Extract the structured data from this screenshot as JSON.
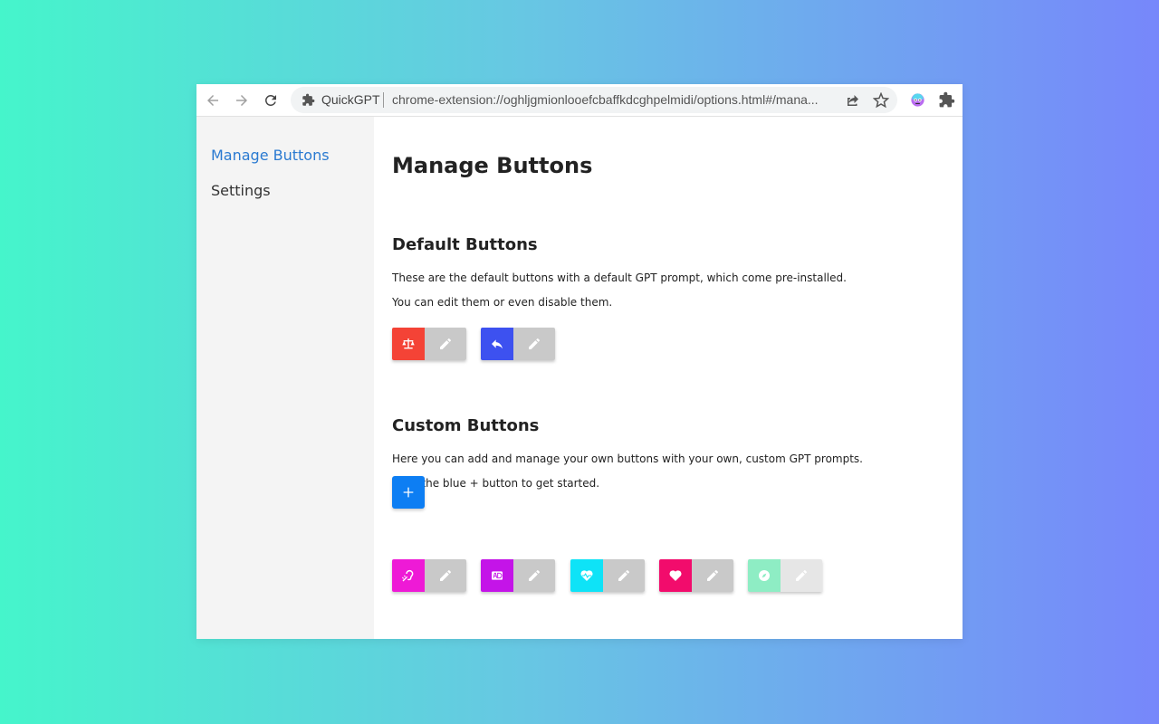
{
  "browser": {
    "site_name": "QuickGPT",
    "url": "chrome-extension://oghljgmionlooefcbaffkdcghpelmidi/options.html#/manage-buttons",
    "url_display": "chrome-extension://oghljgmionlooefcbaffkdcghpelmidi/options.html#/mana..."
  },
  "sidebar": {
    "items": [
      {
        "label": "Manage Buttons",
        "active": true
      },
      {
        "label": "Settings",
        "active": false
      }
    ]
  },
  "main": {
    "title": "Manage Buttons",
    "default_section": {
      "title": "Default Buttons",
      "line1": "These are the default buttons with a default GPT prompt, which come pre-installed.",
      "line2": "You can edit them or even disable them.",
      "buttons": [
        {
          "icon": "balance-scale-icon",
          "color": "#f44336"
        },
        {
          "icon": "reply-icon",
          "color": "#3d51f0"
        }
      ]
    },
    "custom_section": {
      "title": "Custom Buttons",
      "line1": "Here you can add and manage your own buttons with your own, custom GPT prompts.",
      "line2": "Click the blue + button to get started.",
      "add_button_label": "+",
      "add_button_color": "#0d7ef3",
      "buttons": [
        {
          "icon": "ear-deaf-icon",
          "color": "#ee1ad6"
        },
        {
          "icon": "ad-icon",
          "color": "#c414e8"
        },
        {
          "icon": "heart-pulse-icon",
          "color": "#0ee3f7"
        },
        {
          "icon": "heart-icon",
          "color": "#f20c6c"
        },
        {
          "icon": "compass-icon",
          "color": "#8eedc4",
          "disabled": true
        }
      ]
    }
  },
  "colors": {
    "sidebar_active": "#2a7ad1",
    "edit_button": "#c9c9c9"
  }
}
